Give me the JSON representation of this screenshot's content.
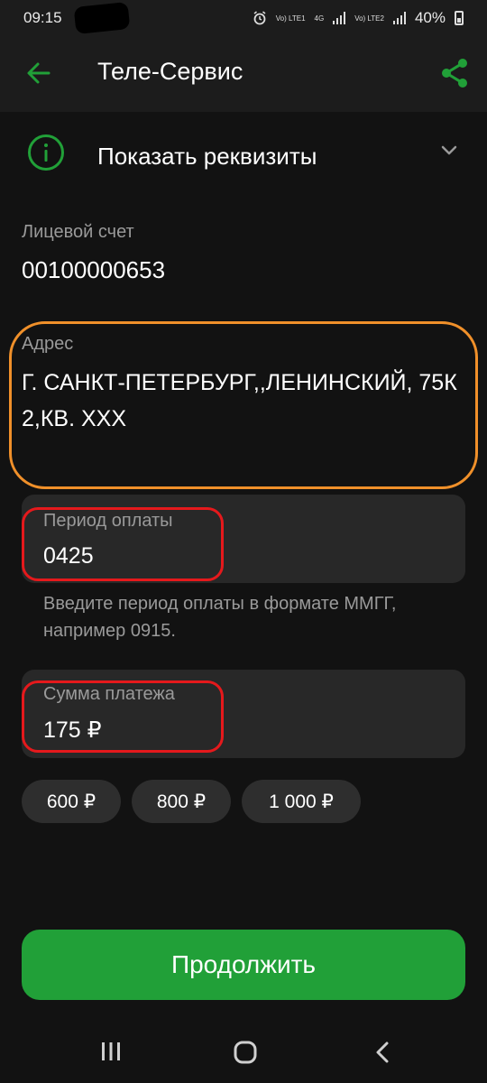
{
  "status_bar": {
    "time": "09:15",
    "network_1": "Vo) LTE1",
    "network_2": "4G",
    "network_3": "Vo) LTE2",
    "battery": "40%"
  },
  "app_bar": {
    "title": "Теле-Сервис",
    "icons": {
      "back": "arrow-left",
      "share": "share"
    }
  },
  "details": {
    "label": "Показать реквизиты",
    "icons": {
      "info": "info-circle",
      "toggle": "chevron-down"
    }
  },
  "account": {
    "label": "Лицевой счет",
    "value": "00100000653"
  },
  "address": {
    "label": "Адрес",
    "value": "Г. САНКТ-ПЕТЕРБУРГ,,ЛЕНИНСКИЙ, 75К2,КВ. XXX"
  },
  "period": {
    "label": "Период оплаты",
    "value": "0425",
    "hint": "Введите период оплаты в формате ММГГ, например 0915."
  },
  "amount": {
    "label": "Сумма платежа",
    "value": "175 ₽"
  },
  "quick_amounts": [
    "600 ₽",
    "800 ₽",
    "1 000 ₽"
  ],
  "continue_label": "Продолжить",
  "colors": {
    "accent_green": "#21a038",
    "annotation_orange": "#f0902a",
    "annotation_red": "#e5191c",
    "background": "#121212"
  },
  "nav_bar": {
    "icons": [
      "recents",
      "home",
      "back"
    ]
  }
}
